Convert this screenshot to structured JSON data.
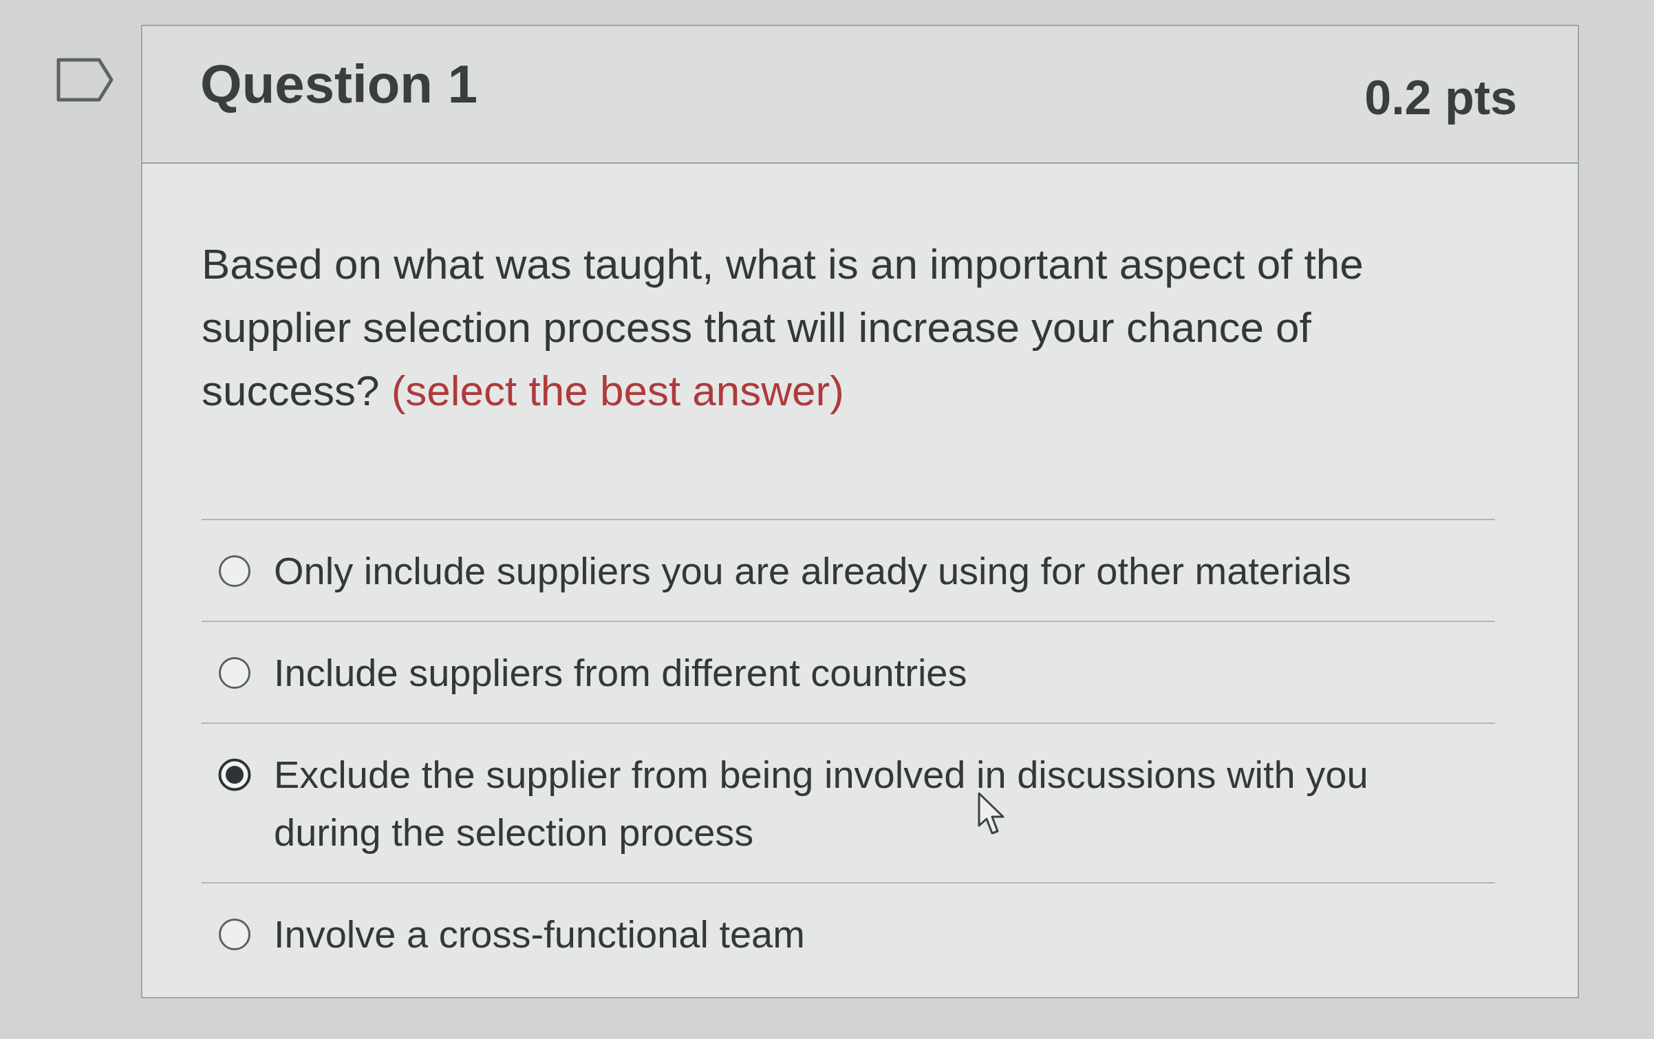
{
  "question": {
    "flagged": false,
    "title": "Question 1",
    "points": "0.2 pts",
    "text": "Based on what was taught, what is an important aspect of the supplier selection process that will increase your chance of success?",
    "instruction": "(select the best answer)"
  },
  "answers": [
    {
      "label": "Only include suppliers you are already using for other materials",
      "selected": false
    },
    {
      "label": "Include suppliers from different countries",
      "selected": false
    },
    {
      "label": "Exclude the supplier from being involved in discussions with you during the selection process",
      "selected": true
    },
    {
      "label": "Involve a cross-functional team",
      "selected": false
    }
  ]
}
